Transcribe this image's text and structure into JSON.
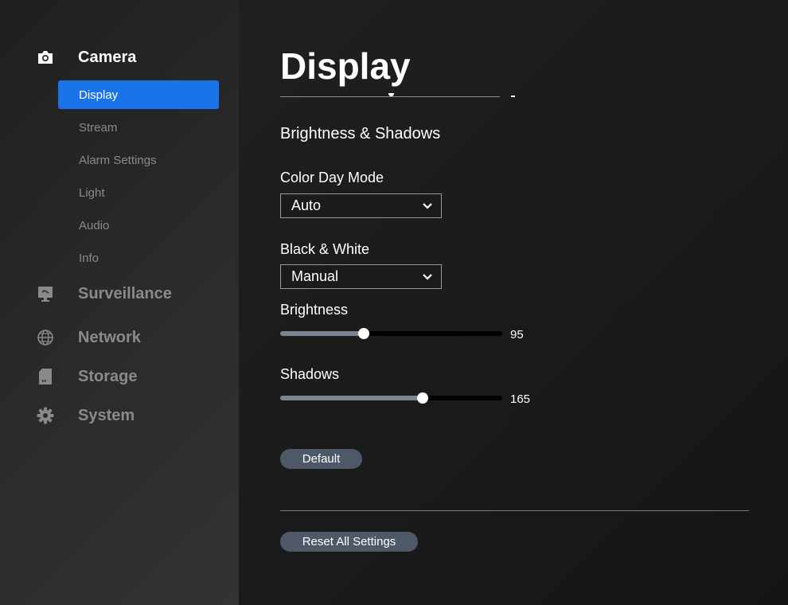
{
  "sidebar": {
    "camera": {
      "label": "Camera",
      "icon": "camera-icon"
    },
    "camera_items": [
      {
        "label": "Display",
        "selected": true
      },
      {
        "label": "Stream"
      },
      {
        "label": "Alarm Settings"
      },
      {
        "label": "Light"
      },
      {
        "label": "Audio"
      },
      {
        "label": "Info"
      }
    ],
    "surveillance": {
      "label": "Surveillance",
      "icon": "monitor-icon"
    },
    "network": {
      "label": "Network",
      "icon": "globe-icon"
    },
    "storage": {
      "label": "Storage",
      "icon": "sd-card-icon"
    },
    "system": {
      "label": "System",
      "icon": "gear-icon"
    }
  },
  "main": {
    "title": "Display",
    "section_heading": "Brightness & Shadows",
    "color_day_mode": {
      "label": "Color Day Mode",
      "value": "Auto"
    },
    "black_white": {
      "label": "Black & White",
      "value": "Manual"
    },
    "brightness": {
      "label": "Brightness",
      "value": "95",
      "fraction": 0.378
    },
    "shadows": {
      "label": "Shadows",
      "value": "165",
      "fraction": 0.64
    },
    "default_button": "Default",
    "reset_button": "Reset All Settings"
  },
  "colors": {
    "accent": "#1a73e8",
    "button_bg": "#4e5866",
    "slider_fill": "#7a8593"
  }
}
